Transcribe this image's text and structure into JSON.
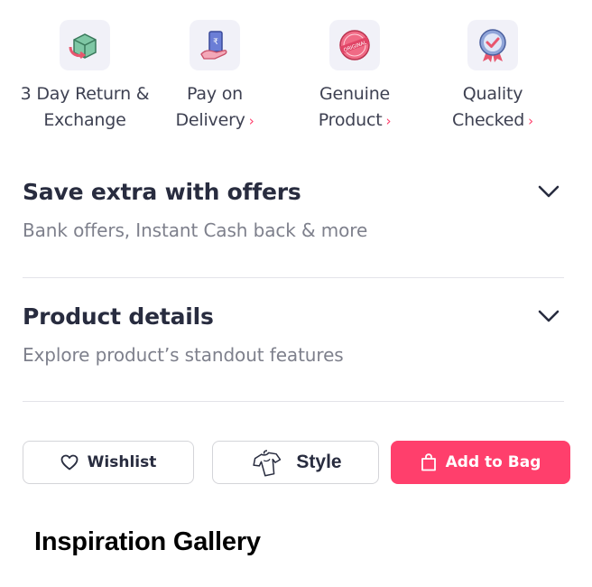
{
  "badges": [
    {
      "line1": "3 Day Return &",
      "line2": "Exchange",
      "icon": "return-box-icon",
      "has_arrow": false
    },
    {
      "line1": "Pay on",
      "line2": "Delivery",
      "icon": "cash-on-delivery-icon",
      "has_arrow": true
    },
    {
      "line1": "Genuine",
      "line2": "Product",
      "icon": "original-stamp-icon",
      "has_arrow": true
    },
    {
      "line1": "Quality",
      "line2": "Checked",
      "icon": "quality-check-icon",
      "has_arrow": true
    }
  ],
  "badge_arrow": "›",
  "offers": {
    "title": "Save extra with offers",
    "subtitle": "Bank offers, Instant Cash back & more"
  },
  "product_details": {
    "title": "Product details",
    "subtitle": "Explore product’s standout features"
  },
  "actions": {
    "wishlist_label": "Wishlist",
    "style_label": "Style",
    "add_to_bag_label": "Add to Bag"
  },
  "gallery": {
    "title": "Inspiration Gallery"
  },
  "colors": {
    "accent": "#ff3f6c",
    "text_primary": "#282c3f",
    "text_secondary": "#7e808c",
    "icon_tile_bg": "#f1f1f8"
  }
}
